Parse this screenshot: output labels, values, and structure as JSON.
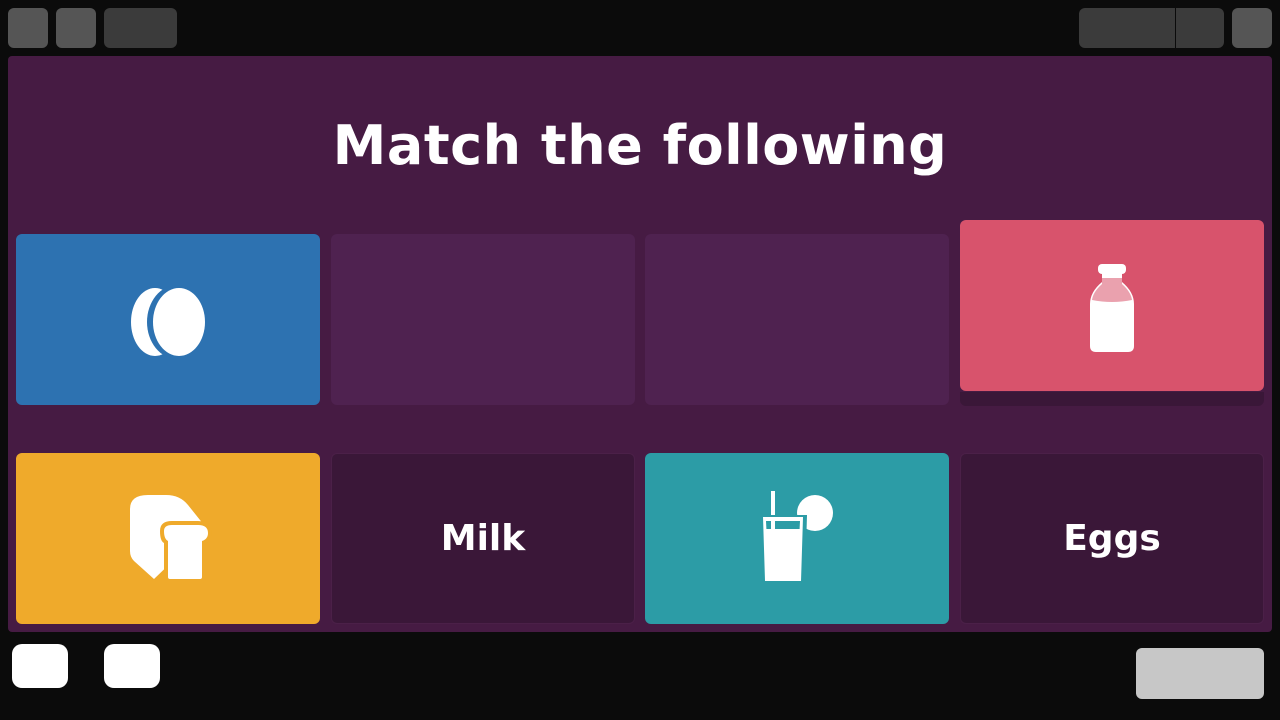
{
  "title": "Match the following",
  "colors": {
    "background": "#461b43",
    "slot": "#4f2250",
    "word_tile": "#3a1738",
    "blue": "#2d72b1",
    "pink": "#d8536c",
    "yellow": "#efaa2b",
    "teal": "#2c9ca6"
  },
  "tiles": [
    {
      "kind": "image",
      "icon": "eggs-icon",
      "color": "blue"
    },
    {
      "kind": "empty-slot"
    },
    {
      "kind": "empty-slot"
    },
    {
      "kind": "image",
      "icon": "milk-bottle-icon",
      "color": "pink"
    },
    {
      "kind": "image",
      "icon": "bread-icon",
      "color": "yellow"
    },
    {
      "kind": "word",
      "label": "Milk"
    },
    {
      "kind": "image",
      "icon": "juice-glass-icon",
      "color": "teal"
    },
    {
      "kind": "word",
      "label": "Eggs"
    }
  ]
}
